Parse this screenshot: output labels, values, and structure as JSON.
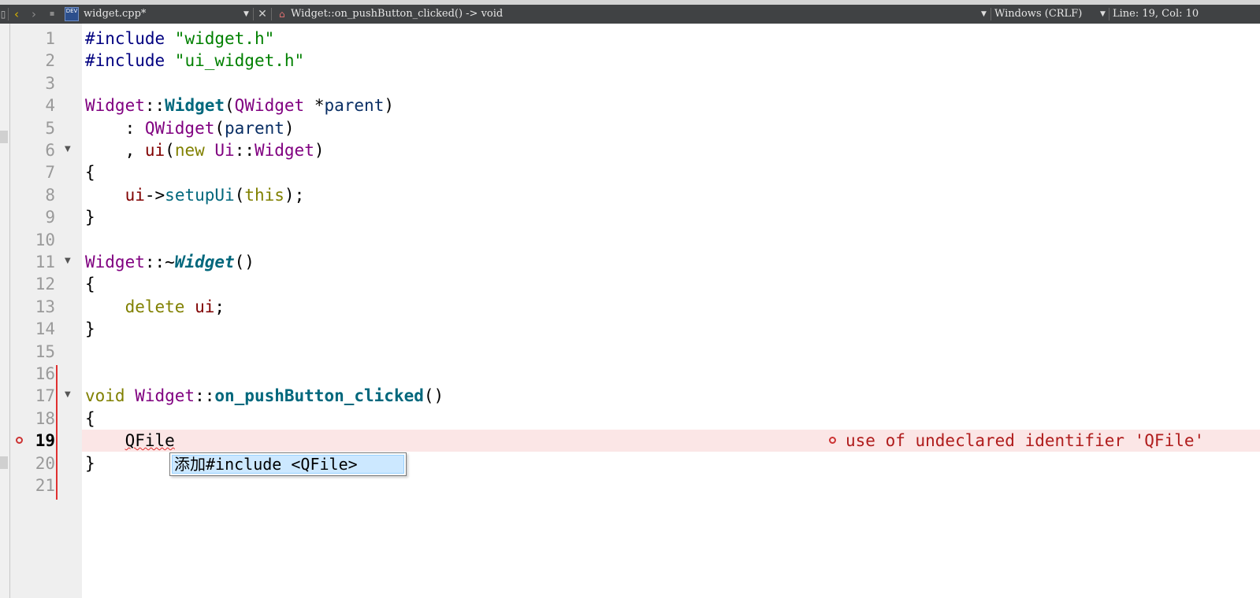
{
  "toolbar": {
    "back_icon": "chevron-left-icon",
    "forward_icon": "chevron-right-icon",
    "lock_icon": "lock-icon",
    "file_badge_text": "DEV",
    "file_name": "widget.cpp*",
    "close_icon": "close-icon",
    "symbol_icon": "function-symbol-icon",
    "symbol": "Widget::on_pushButton_clicked() -> void",
    "line_endings": "Windows (CRLF)",
    "cursor_position": "Line: 19, Col: 10"
  },
  "editor": {
    "lines": [
      {
        "n": "1",
        "tokens": [
          [
            "pp",
            "#include "
          ],
          [
            "str",
            "\"widget.h\""
          ]
        ]
      },
      {
        "n": "2",
        "tokens": [
          [
            "pp",
            "#include "
          ],
          [
            "str",
            "\"ui_widget.h\""
          ]
        ]
      },
      {
        "n": "3",
        "tokens": []
      },
      {
        "n": "4",
        "tokens": [
          [
            "cls",
            "Widget"
          ],
          [
            "op",
            "::"
          ],
          [
            "fn-decl",
            "Widget"
          ],
          [
            "op",
            "("
          ],
          [
            "cls",
            "QWidget"
          ],
          [
            "op",
            " *"
          ],
          [
            "var",
            "parent"
          ],
          [
            "op",
            ")"
          ]
        ]
      },
      {
        "n": "5",
        "tokens": [
          [
            "op",
            "    : "
          ],
          [
            "cls",
            "QWidget"
          ],
          [
            "op",
            "("
          ],
          [
            "var",
            "parent"
          ],
          [
            "op",
            ")"
          ]
        ]
      },
      {
        "n": "6",
        "tokens": [
          [
            "op",
            "    , "
          ],
          [
            "mem",
            "ui"
          ],
          [
            "op",
            "("
          ],
          [
            "kw",
            "new "
          ],
          [
            "cls",
            "Ui"
          ],
          [
            "op",
            "::"
          ],
          [
            "cls",
            "Widget"
          ],
          [
            "op",
            ")"
          ]
        ],
        "fold": true
      },
      {
        "n": "7",
        "tokens": [
          [
            "op",
            "{"
          ]
        ]
      },
      {
        "n": "8",
        "tokens": [
          [
            "op",
            "    "
          ],
          [
            "mem",
            "ui"
          ],
          [
            "op",
            "->"
          ],
          [
            "fn",
            "setupUi"
          ],
          [
            "op",
            "("
          ],
          [
            "kw",
            "this"
          ],
          [
            "op",
            ");"
          ]
        ]
      },
      {
        "n": "9",
        "tokens": [
          [
            "op",
            "}"
          ]
        ]
      },
      {
        "n": "10",
        "tokens": []
      },
      {
        "n": "11",
        "tokens": [
          [
            "cls",
            "Widget"
          ],
          [
            "op",
            "::~"
          ],
          [
            "fn-decl-it",
            "Widget"
          ],
          [
            "op",
            "()"
          ]
        ],
        "fold": true
      },
      {
        "n": "12",
        "tokens": [
          [
            "op",
            "{"
          ]
        ]
      },
      {
        "n": "13",
        "tokens": [
          [
            "op",
            "    "
          ],
          [
            "kw",
            "delete "
          ],
          [
            "mem",
            "ui"
          ],
          [
            "op",
            ";"
          ]
        ]
      },
      {
        "n": "14",
        "tokens": [
          [
            "op",
            "}"
          ]
        ]
      },
      {
        "n": "15",
        "tokens": []
      },
      {
        "n": "16",
        "tokens": []
      },
      {
        "n": "17",
        "tokens": [
          [
            "kw",
            "void "
          ],
          [
            "cls",
            "Widget"
          ],
          [
            "op",
            "::"
          ],
          [
            "fn-decl",
            "on_pushButton_clicked"
          ],
          [
            "op",
            "()"
          ]
        ],
        "fold": true
      },
      {
        "n": "18",
        "tokens": [
          [
            "op",
            "{"
          ]
        ]
      },
      {
        "n": "19",
        "tokens": [
          [
            "op",
            "    "
          ],
          [
            "squiggle",
            "QFile"
          ]
        ],
        "current": true,
        "error": true
      },
      {
        "n": "20",
        "tokens": [
          [
            "op",
            "}"
          ]
        ]
      },
      {
        "n": "21",
        "tokens": []
      }
    ],
    "error_message": "use of undeclared identifier 'QFile'",
    "error_icon": "error-circle-icon",
    "fold_icon": "fold-arrow-icon"
  },
  "completion": {
    "item": "添加#include <QFile>"
  }
}
